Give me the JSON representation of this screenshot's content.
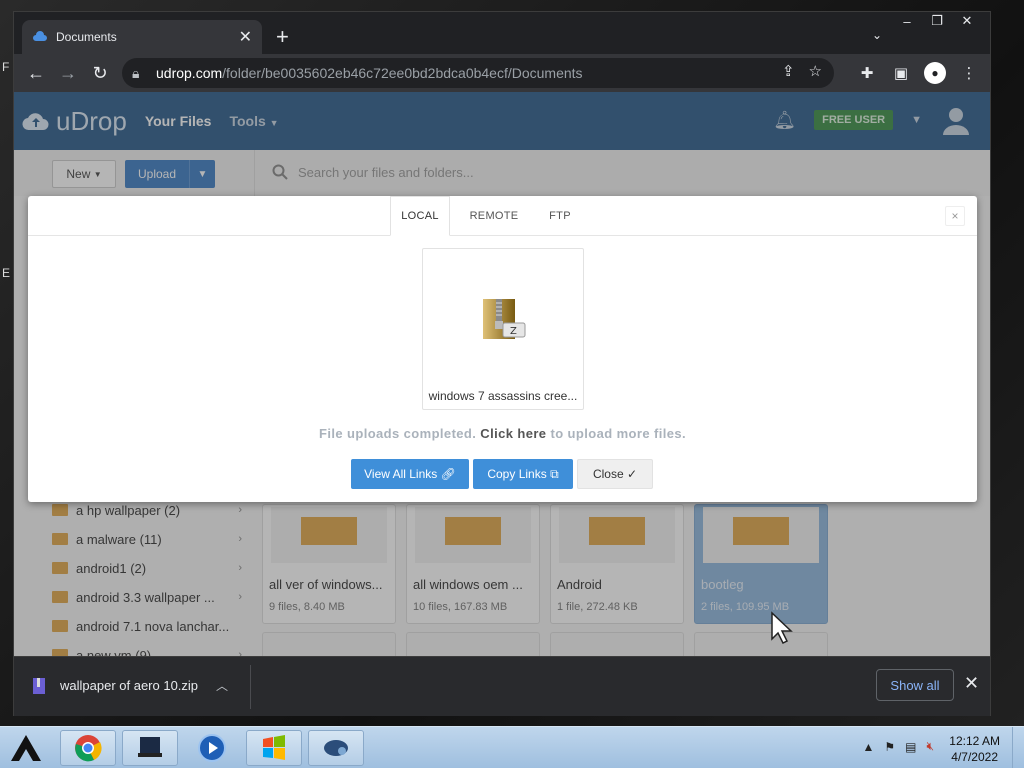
{
  "desktop": {
    "edge_chars": [
      "F",
      "E"
    ]
  },
  "browser": {
    "tab_title": "Documents",
    "window_controls": [
      "–",
      "❐",
      "✕"
    ],
    "url_host": "udrop.com",
    "url_path": "/folder/be0035602eb46c72ee0bd2bdca0b4ecf/Documents"
  },
  "header": {
    "logo_text": "uDrop",
    "nav": {
      "your_files": "Your Files",
      "tools": "Tools"
    },
    "badge": "FREE USER"
  },
  "subbar": {
    "new_label": "New",
    "upload_label": "Upload",
    "search_placeholder": "Search your files and folders..."
  },
  "sidebar": {
    "folders": [
      {
        "label": "a hp wallpaper (2)",
        "has_children": true
      },
      {
        "label": "a malware (11)",
        "has_children": true
      },
      {
        "label": "android1 (2)",
        "has_children": true
      },
      {
        "label": "android 3.3 wallpaper ...",
        "has_children": true
      },
      {
        "label": "android 7.1 nova lanchar...",
        "has_children": false
      },
      {
        "label": "a new vm (9)",
        "has_children": true
      }
    ]
  },
  "folder_cards": [
    {
      "name": "all ver of windows...",
      "meta": "9 files, 8.40 MB",
      "selected": false
    },
    {
      "name": "all windows oem ...",
      "meta": "10 files, 167.83 MB",
      "selected": false
    },
    {
      "name": "Android",
      "meta": "1 file, 272.48 KB",
      "selected": false
    },
    {
      "name": "bootleg",
      "meta": "2 files, 109.95 MB",
      "selected": true
    }
  ],
  "modal": {
    "tabs": [
      "LOCAL",
      "REMOTE",
      "FTP"
    ],
    "active_tab": "LOCAL",
    "close_glyph": "×",
    "file_name": "windows 7 assassins cree...",
    "message_before": "File uploads completed.",
    "message_link": "Click here",
    "message_after": "to upload more files.",
    "buttons": {
      "view_all_links": "View All Links",
      "copy_links": "Copy Links",
      "close": "Close"
    }
  },
  "downloads": {
    "file": "wallpaper of aero 10.zip",
    "show_all": "Show all"
  },
  "taskbar": {
    "time": "12:12 AM",
    "date": "4/7/2022"
  },
  "colors": {
    "header_bg": "#2d5d8c",
    "primary_button": "#3f8fd9",
    "free_badge": "#3a8f46",
    "selected_card": "#8fb7de"
  }
}
